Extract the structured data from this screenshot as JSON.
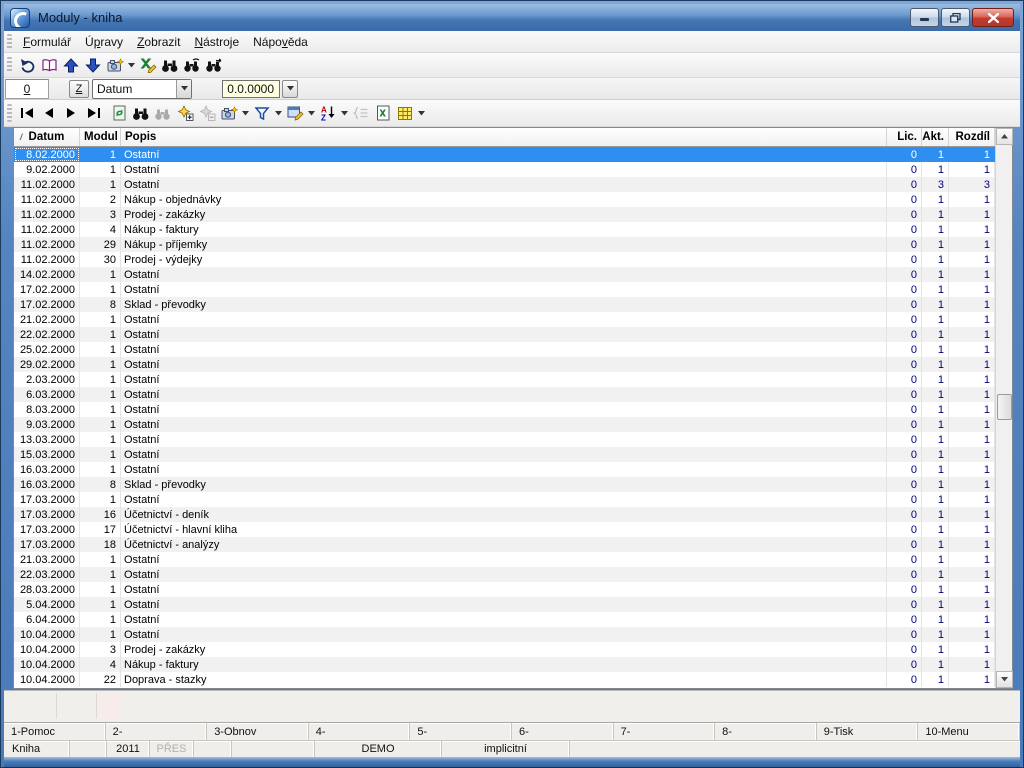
{
  "window": {
    "title": "Moduly - kniha",
    "buttons": [
      "minimize-button",
      "restore-button",
      "close-button"
    ]
  },
  "menu": {
    "items": [
      {
        "label": "Formulář",
        "key": "F"
      },
      {
        "label": "Úpravy",
        "key": "p"
      },
      {
        "label": "Zobrazit",
        "key": "Z"
      },
      {
        "label": "Nástroje",
        "key": "N"
      },
      {
        "label": "Nápověda",
        "key": "v"
      }
    ]
  },
  "toolbar_main": {
    "icons": [
      "undo-icon",
      "book-icon",
      "move-up-icon",
      "move-down-icon",
      "snapshot-icon",
      "snapshot-caret-icon",
      "excel-edit-icon",
      "find-icon",
      "find-again-icon",
      "find-goto-icon"
    ]
  },
  "filter_bar": {
    "counter": "0",
    "z_button_label": "Z",
    "field_selector_value": "Datum",
    "value_field": "0.0.0000"
  },
  "toolbar_nav": {
    "icons": [
      "first-record-icon",
      "prev-record-icon",
      "next-record-icon",
      "last-record-icon",
      "refresh-icon",
      "find-icon",
      "find-again-icon",
      "add-record-icon",
      "delete-record-icon",
      "snapshot-icon",
      "filter-icon",
      "edit-form-icon",
      "sort-az-icon",
      "list-icon",
      "excel-export-icon",
      "columns-icon"
    ]
  },
  "table": {
    "headers": [
      "Datum",
      "Modul",
      "Popis",
      "Lic.",
      "Akt.",
      "Rozdíl"
    ],
    "sort_indicator": "asc",
    "selected_index": 0,
    "rows": [
      [
        "8.02.2000",
        "1",
        "Ostatní",
        "0",
        "1",
        "1"
      ],
      [
        "9.02.2000",
        "1",
        "Ostatní",
        "0",
        "1",
        "1"
      ],
      [
        "11.02.2000",
        "1",
        "Ostatní",
        "0",
        "3",
        "3"
      ],
      [
        "11.02.2000",
        "2",
        "Nákup - objednávky",
        "0",
        "1",
        "1"
      ],
      [
        "11.02.2000",
        "3",
        "Prodej - zakázky",
        "0",
        "1",
        "1"
      ],
      [
        "11.02.2000",
        "4",
        "Nákup - faktury",
        "0",
        "1",
        "1"
      ],
      [
        "11.02.2000",
        "29",
        "Nákup - příjemky",
        "0",
        "1",
        "1"
      ],
      [
        "11.02.2000",
        "30",
        "Prodej - výdejky",
        "0",
        "1",
        "1"
      ],
      [
        "14.02.2000",
        "1",
        "Ostatní",
        "0",
        "1",
        "1"
      ],
      [
        "17.02.2000",
        "1",
        "Ostatní",
        "0",
        "1",
        "1"
      ],
      [
        "17.02.2000",
        "8",
        "Sklad - převodky",
        "0",
        "1",
        "1"
      ],
      [
        "21.02.2000",
        "1",
        "Ostatní",
        "0",
        "1",
        "1"
      ],
      [
        "22.02.2000",
        "1",
        "Ostatní",
        "0",
        "1",
        "1"
      ],
      [
        "25.02.2000",
        "1",
        "Ostatní",
        "0",
        "1",
        "1"
      ],
      [
        "29.02.2000",
        "1",
        "Ostatní",
        "0",
        "1",
        "1"
      ],
      [
        "2.03.2000",
        "1",
        "Ostatní",
        "0",
        "1",
        "1"
      ],
      [
        "6.03.2000",
        "1",
        "Ostatní",
        "0",
        "1",
        "1"
      ],
      [
        "8.03.2000",
        "1",
        "Ostatní",
        "0",
        "1",
        "1"
      ],
      [
        "9.03.2000",
        "1",
        "Ostatní",
        "0",
        "1",
        "1"
      ],
      [
        "13.03.2000",
        "1",
        "Ostatní",
        "0",
        "1",
        "1"
      ],
      [
        "15.03.2000",
        "1",
        "Ostatní",
        "0",
        "1",
        "1"
      ],
      [
        "16.03.2000",
        "1",
        "Ostatní",
        "0",
        "1",
        "1"
      ],
      [
        "16.03.2000",
        "8",
        "Sklad - převodky",
        "0",
        "1",
        "1"
      ],
      [
        "17.03.2000",
        "1",
        "Ostatní",
        "0",
        "1",
        "1"
      ],
      [
        "17.03.2000",
        "16",
        "Účetnictví - deník",
        "0",
        "1",
        "1"
      ],
      [
        "17.03.2000",
        "17",
        "Účetnictví - hlavní kliha",
        "0",
        "1",
        "1"
      ],
      [
        "17.03.2000",
        "18",
        "Účetnictví - analýzy",
        "0",
        "1",
        "1"
      ],
      [
        "21.03.2000",
        "1",
        "Ostatní",
        "0",
        "1",
        "1"
      ],
      [
        "22.03.2000",
        "1",
        "Ostatní",
        "0",
        "1",
        "1"
      ],
      [
        "28.03.2000",
        "1",
        "Ostatní",
        "0",
        "1",
        "1"
      ],
      [
        "5.04.2000",
        "1",
        "Ostatní",
        "0",
        "1",
        "1"
      ],
      [
        "6.04.2000",
        "1",
        "Ostatní",
        "0",
        "1",
        "1"
      ],
      [
        "10.04.2000",
        "1",
        "Ostatní",
        "0",
        "1",
        "1"
      ],
      [
        "10.04.2000",
        "3",
        "Prodej - zakázky",
        "0",
        "1",
        "1"
      ],
      [
        "10.04.2000",
        "4",
        "Nákup - faktury",
        "0",
        "1",
        "1"
      ],
      [
        "10.04.2000",
        "22",
        "Doprava - stazky",
        "0",
        "1",
        "1"
      ]
    ]
  },
  "function_keys": [
    "1-Pomoc",
    "2-",
    "3-Obnov",
    "4-",
    "5-",
    "6-",
    "7-",
    "8-",
    "9-Tisk",
    "10-Menu"
  ],
  "status_bar": {
    "panels": [
      {
        "text": "Kniha"
      },
      {
        "text": ""
      },
      {
        "text": "2011"
      },
      {
        "text": "PŘES",
        "muted": true
      },
      {
        "text": ""
      },
      {
        "text": ""
      },
      {
        "text": "DEMO"
      },
      {
        "text": "implicitní"
      },
      {
        "text": ""
      }
    ]
  },
  "colors": {
    "titlebar": "#4a7ab8",
    "selection": "#2f8ff0",
    "numeric_text": "#000080",
    "value_field_bg": "#ffffe1",
    "close_button": "#c03b2d"
  }
}
